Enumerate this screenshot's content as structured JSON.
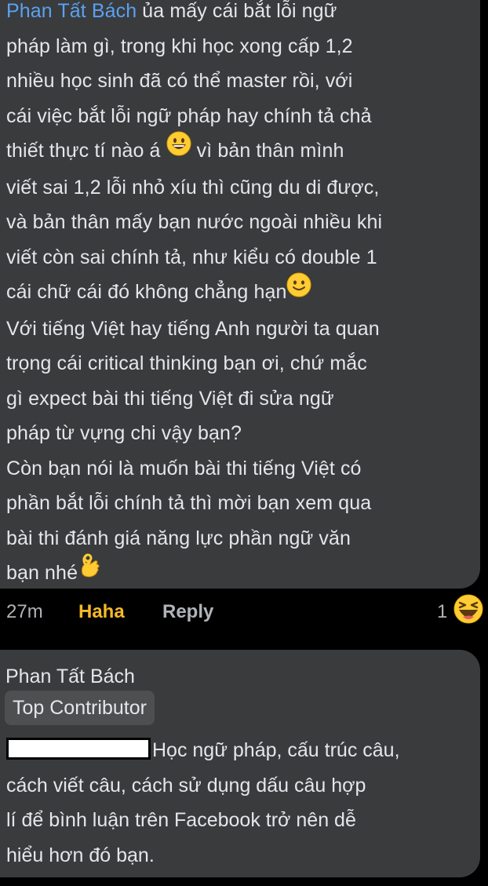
{
  "comment1": {
    "author": "Phan Tất Bách",
    "lines": [
      " ủa mấy cái bắt lỗi ngữ",
      "pháp làm gì, trong khi học xong cấp 1,2",
      "nhiều học sinh đã có thể master rồi, với",
      "cái việc bắt lỗi ngữ pháp hay chính tả chả",
      "thiết thực tí nào á",
      " vì bản thân mình",
      "viết sai 1,2 lỗi nhỏ xíu thì cũng du di được,",
      "và bản thân mấy bạn nước ngoài nhiều khi",
      "viết còn sai chính tả, như kiểu có double 1",
      "cái chữ cái đó không chẳng hạn",
      "Với tiếng Việt hay tiếng Anh người ta quan",
      "trọng cái critical thinking bạn ơi, chứ mắc",
      "gì expect bài thi tiếng Việt đi sửa ngữ",
      "pháp từ vựng chi vậy bạn?",
      "Còn bạn nói là muốn bài thi tiếng Việt có",
      "phần bắt lỗi chính tả thì mời bạn xem qua",
      "bài thi đánh giá năng lực phần ngữ văn",
      "bạn nhé"
    ],
    "emoji_grin": "grinning-face-icon",
    "emoji_smile": "slightly-smiling-face-icon",
    "emoji_ok": "ok-hand-icon"
  },
  "actions": {
    "time": "27m",
    "reaction_label": "Haha",
    "reply_label": "Reply",
    "reaction_count": "1",
    "reaction_icon": "laughing-squint-face-icon"
  },
  "comment2": {
    "author": "Phan Tất Bách",
    "badge": "Top Contributor",
    "lines": [
      "Học ngữ pháp, cấu trúc câu,",
      "cách viết câu, cách sử dụng dấu câu hợp",
      "lí để bình luận trên Facebook trở nên dễ",
      "hiểu hơn đó bạn."
    ]
  },
  "colors": {
    "background": "#000000",
    "bubble": "#3a3b3d",
    "text": "#e4e6eb",
    "muted": "#b0b3b8",
    "link": "#5ba1f1",
    "haha": "#f7b928",
    "badge": "#4e4f50"
  }
}
